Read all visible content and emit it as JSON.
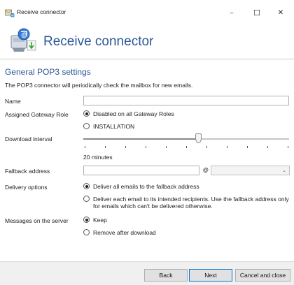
{
  "window": {
    "title": "Receive connector",
    "minimize_glyph": "–",
    "maximize_glyph": "☐",
    "close_glyph": "✕",
    "icon": "connector-icon"
  },
  "header": {
    "heading": "Receive connector",
    "icon": "mailbox-download-icon"
  },
  "section": {
    "title": "General POP3 settings",
    "description": "The POP3 connector will periodically check the mailbox for new emails."
  },
  "fields": {
    "name": {
      "label": "Name",
      "value": "",
      "placeholder": ""
    },
    "gateway_role": {
      "label": "Assigned Gateway Role",
      "options": [
        {
          "label": "Disabled on all Gateway Roles",
          "selected": true
        },
        {
          "label": "INSTALLATION",
          "selected": false
        }
      ]
    },
    "download_interval": {
      "label": "Download interval",
      "value_text": "20 minutes",
      "position_fraction": 0.56,
      "tick_count": 11
    },
    "fallback_address": {
      "label": "Fallback address",
      "local_part": "",
      "at_symbol": "@",
      "domain": ""
    },
    "delivery_options": {
      "label": "Delivery options",
      "options": [
        {
          "label": "Deliver all emails to the fallback address",
          "selected": true
        },
        {
          "label": "Deliver each email to its intended recipients. Use the fallback address only for emails which can't be delivered otherwise.",
          "selected": false
        }
      ]
    },
    "messages_on_server": {
      "label": "Messages on the server",
      "options": [
        {
          "label": "Keep",
          "selected": true
        },
        {
          "label": "Remove after download",
          "selected": false
        }
      ]
    }
  },
  "buttons": {
    "back": "Back",
    "next": "Next",
    "cancel": "Cancel and close"
  },
  "colors": {
    "heading": "#2b5797",
    "accent": "#0078d7"
  }
}
